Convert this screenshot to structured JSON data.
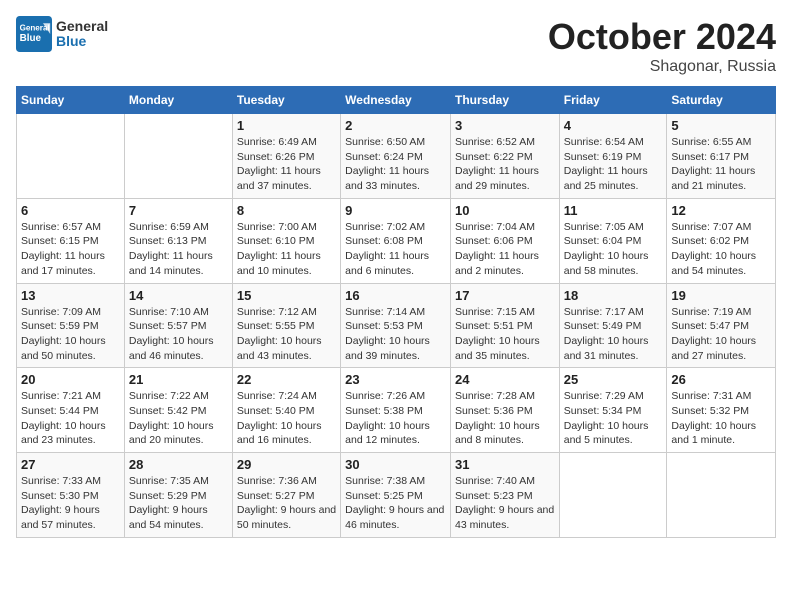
{
  "header": {
    "logo_general": "General",
    "logo_blue": "Blue",
    "month_title": "October 2024",
    "location": "Shagonar, Russia"
  },
  "days_of_week": [
    "Sunday",
    "Monday",
    "Tuesday",
    "Wednesday",
    "Thursday",
    "Friday",
    "Saturday"
  ],
  "weeks": [
    [
      {
        "day": "",
        "info": ""
      },
      {
        "day": "",
        "info": ""
      },
      {
        "day": "1",
        "info": "Sunrise: 6:49 AM\nSunset: 6:26 PM\nDaylight: 11 hours and 37 minutes."
      },
      {
        "day": "2",
        "info": "Sunrise: 6:50 AM\nSunset: 6:24 PM\nDaylight: 11 hours and 33 minutes."
      },
      {
        "day": "3",
        "info": "Sunrise: 6:52 AM\nSunset: 6:22 PM\nDaylight: 11 hours and 29 minutes."
      },
      {
        "day": "4",
        "info": "Sunrise: 6:54 AM\nSunset: 6:19 PM\nDaylight: 11 hours and 25 minutes."
      },
      {
        "day": "5",
        "info": "Sunrise: 6:55 AM\nSunset: 6:17 PM\nDaylight: 11 hours and 21 minutes."
      }
    ],
    [
      {
        "day": "6",
        "info": "Sunrise: 6:57 AM\nSunset: 6:15 PM\nDaylight: 11 hours and 17 minutes."
      },
      {
        "day": "7",
        "info": "Sunrise: 6:59 AM\nSunset: 6:13 PM\nDaylight: 11 hours and 14 minutes."
      },
      {
        "day": "8",
        "info": "Sunrise: 7:00 AM\nSunset: 6:10 PM\nDaylight: 11 hours and 10 minutes."
      },
      {
        "day": "9",
        "info": "Sunrise: 7:02 AM\nSunset: 6:08 PM\nDaylight: 11 hours and 6 minutes."
      },
      {
        "day": "10",
        "info": "Sunrise: 7:04 AM\nSunset: 6:06 PM\nDaylight: 11 hours and 2 minutes."
      },
      {
        "day": "11",
        "info": "Sunrise: 7:05 AM\nSunset: 6:04 PM\nDaylight: 10 hours and 58 minutes."
      },
      {
        "day": "12",
        "info": "Sunrise: 7:07 AM\nSunset: 6:02 PM\nDaylight: 10 hours and 54 minutes."
      }
    ],
    [
      {
        "day": "13",
        "info": "Sunrise: 7:09 AM\nSunset: 5:59 PM\nDaylight: 10 hours and 50 minutes."
      },
      {
        "day": "14",
        "info": "Sunrise: 7:10 AM\nSunset: 5:57 PM\nDaylight: 10 hours and 46 minutes."
      },
      {
        "day": "15",
        "info": "Sunrise: 7:12 AM\nSunset: 5:55 PM\nDaylight: 10 hours and 43 minutes."
      },
      {
        "day": "16",
        "info": "Sunrise: 7:14 AM\nSunset: 5:53 PM\nDaylight: 10 hours and 39 minutes."
      },
      {
        "day": "17",
        "info": "Sunrise: 7:15 AM\nSunset: 5:51 PM\nDaylight: 10 hours and 35 minutes."
      },
      {
        "day": "18",
        "info": "Sunrise: 7:17 AM\nSunset: 5:49 PM\nDaylight: 10 hours and 31 minutes."
      },
      {
        "day": "19",
        "info": "Sunrise: 7:19 AM\nSunset: 5:47 PM\nDaylight: 10 hours and 27 minutes."
      }
    ],
    [
      {
        "day": "20",
        "info": "Sunrise: 7:21 AM\nSunset: 5:44 PM\nDaylight: 10 hours and 23 minutes."
      },
      {
        "day": "21",
        "info": "Sunrise: 7:22 AM\nSunset: 5:42 PM\nDaylight: 10 hours and 20 minutes."
      },
      {
        "day": "22",
        "info": "Sunrise: 7:24 AM\nSunset: 5:40 PM\nDaylight: 10 hours and 16 minutes."
      },
      {
        "day": "23",
        "info": "Sunrise: 7:26 AM\nSunset: 5:38 PM\nDaylight: 10 hours and 12 minutes."
      },
      {
        "day": "24",
        "info": "Sunrise: 7:28 AM\nSunset: 5:36 PM\nDaylight: 10 hours and 8 minutes."
      },
      {
        "day": "25",
        "info": "Sunrise: 7:29 AM\nSunset: 5:34 PM\nDaylight: 10 hours and 5 minutes."
      },
      {
        "day": "26",
        "info": "Sunrise: 7:31 AM\nSunset: 5:32 PM\nDaylight: 10 hours and 1 minute."
      }
    ],
    [
      {
        "day": "27",
        "info": "Sunrise: 7:33 AM\nSunset: 5:30 PM\nDaylight: 9 hours and 57 minutes."
      },
      {
        "day": "28",
        "info": "Sunrise: 7:35 AM\nSunset: 5:29 PM\nDaylight: 9 hours and 54 minutes."
      },
      {
        "day": "29",
        "info": "Sunrise: 7:36 AM\nSunset: 5:27 PM\nDaylight: 9 hours and 50 minutes."
      },
      {
        "day": "30",
        "info": "Sunrise: 7:38 AM\nSunset: 5:25 PM\nDaylight: 9 hours and 46 minutes."
      },
      {
        "day": "31",
        "info": "Sunrise: 7:40 AM\nSunset: 5:23 PM\nDaylight: 9 hours and 43 minutes."
      },
      {
        "day": "",
        "info": ""
      },
      {
        "day": "",
        "info": ""
      }
    ]
  ]
}
